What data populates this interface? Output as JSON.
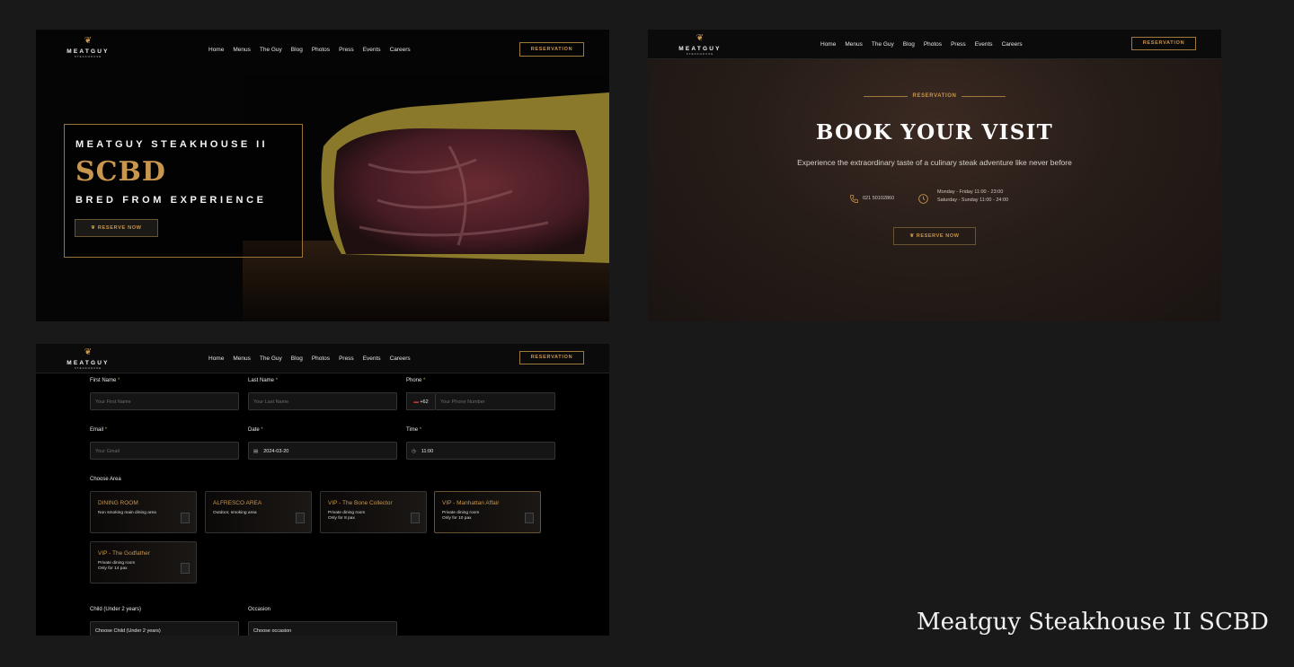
{
  "nav": {
    "brand_wordmark": "MEATGUY",
    "brand_sub": "STEAKHOUSE",
    "items": [
      "Home",
      "Menus",
      "The Guy",
      "Blog",
      "Photos",
      "Press",
      "Events",
      "Careers"
    ],
    "reservation_label": "RESERVATION"
  },
  "hero": {
    "kicker": "MEATGUY STEAKHOUSE II",
    "title": "SCBD",
    "tagline": "BRED FROM EXPERIENCE",
    "button_label": "RESERVE NOW"
  },
  "booking": {
    "eyebrow": "RESERVATION",
    "title": "BOOK YOUR VISIT",
    "description": "Experience the extraordinary taste of a culinary steak adventure like never before",
    "phone": "021 50102860",
    "hours_weekday": "Monday - Friday 11:00 - 23:00",
    "hours_weekend": "Saturday - Sunday 11:00 - 24:00",
    "button_label": "RESERVE NOW"
  },
  "form": {
    "first_name": {
      "label": "First Name",
      "placeholder": "Your First Name"
    },
    "last_name": {
      "label": "Last Name",
      "placeholder": "Your Last Name"
    },
    "phone": {
      "label": "Phone",
      "code": "+62",
      "placeholder": "Your Phone Number"
    },
    "email": {
      "label": "Email",
      "placeholder": "Your Gmail"
    },
    "date": {
      "label": "Date",
      "value": "2024-03-20"
    },
    "time": {
      "label": "Time",
      "value": "11:00"
    },
    "area_label": "Choose Area",
    "areas": [
      {
        "title": "DINING ROOM",
        "desc": "Non smoking main dining area"
      },
      {
        "title": "ALFRESCO AREA",
        "desc": "Outdoor, smoking area"
      },
      {
        "title": "VIP - The Bone Collector",
        "desc": "Private dining room\nOnly for 8 pax"
      },
      {
        "title": "VIP - Manhattan Affair",
        "desc": "Private dining room\nOnly for 10 pax"
      },
      {
        "title": "VIP - The Godfather",
        "desc": "Private dining room\nOnly for 14 pax"
      }
    ],
    "child_label": "Child (Under 2 years)",
    "child_value": "Choose Child (Under 2 years)",
    "occasion_label": "Occasion",
    "occasion_value": "Choose occasion"
  },
  "caption": "Meatguy Steakhouse II SCBD",
  "colors": {
    "accent": "#c8964e",
    "background": "#191919"
  }
}
